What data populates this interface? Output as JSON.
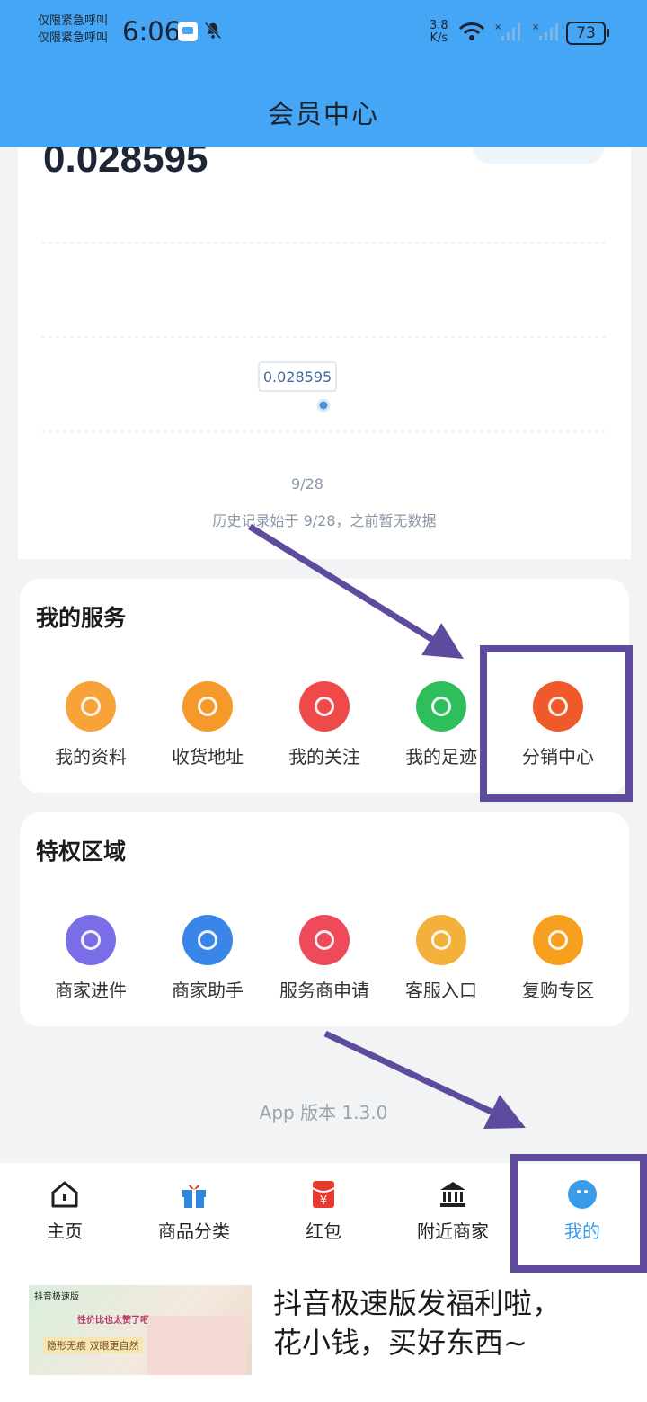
{
  "status_bar": {
    "carrier_line1": "仅限紧急呼叫",
    "carrier_line2": "仅限紧急呼叫",
    "time": "6:06",
    "net_speed_value": "3.8",
    "net_speed_unit": "K/s",
    "battery": "73"
  },
  "header": {
    "title": "会员中心"
  },
  "chart": {
    "current_value": "0.028595",
    "point_label": "0.028595",
    "x_label": "9/28",
    "history_note": "历史记录始于 9/28，之前暂无数据"
  },
  "chart_data": {
    "type": "line",
    "x": [
      "9/28"
    ],
    "values": [
      0.028595
    ],
    "title": "",
    "xlabel": "",
    "ylabel": "",
    "grid": true
  },
  "services": {
    "title": "我的服务",
    "items": [
      {
        "label": "我的资料",
        "icon": "profile-card-icon",
        "color": "#f7a33a"
      },
      {
        "label": "收货地址",
        "icon": "location-pin-icon",
        "color": "#f59a2a"
      },
      {
        "label": "我的关注",
        "icon": "heart-icon",
        "color": "#ee4a4a"
      },
      {
        "label": "我的足迹",
        "icon": "paw-icon",
        "color": "#2fbe5c"
      },
      {
        "label": "分销中心",
        "icon": "distribution-icon",
        "color": "#f05a2a"
      }
    ]
  },
  "privileges": {
    "title": "特权区域",
    "items": [
      {
        "label": "商家进件",
        "icon": "basket-icon",
        "color": "#7a6de8"
      },
      {
        "label": "商家助手",
        "icon": "assistant-icon",
        "color": "#3a86e8"
      },
      {
        "label": "服务商申请",
        "icon": "flame-icon",
        "color": "#ee4a5a"
      },
      {
        "label": "客服入口",
        "icon": "support-agent-icon",
        "color": "#f3b03a"
      },
      {
        "label": "复购专区",
        "icon": "coins-icon",
        "color": "#f7a020"
      }
    ]
  },
  "app_version": "App 版本 1.3.0",
  "bottom_nav": {
    "items": [
      {
        "label": "主页",
        "icon": "home-icon"
      },
      {
        "label": "商品分类",
        "icon": "gift-box-icon"
      },
      {
        "label": "红包",
        "icon": "red-envelope-icon"
      },
      {
        "label": "附近商家",
        "icon": "bank-icon"
      },
      {
        "label": "我的",
        "icon": "mine-icon"
      }
    ],
    "active_index": 4
  },
  "ad": {
    "brand": "抖音极速版",
    "slogan": "性价比也太赞了吧!",
    "sub": "隐形无痕 双眼更自然",
    "headline_line1": "抖音极速版发福利啦，",
    "headline_line2": "花小钱，买好东西~"
  },
  "colors": {
    "header_bg": "#45a6f5",
    "accent": "#3a9be8",
    "annotation": "#5e4b9e"
  }
}
